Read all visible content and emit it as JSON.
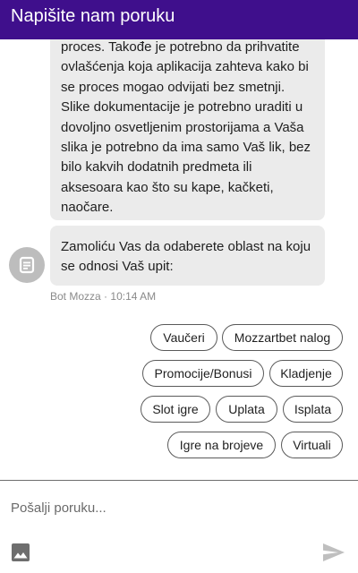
{
  "header": {
    "title": "Napišite nam poruku"
  },
  "messages": [
    {
      "sender": "bot",
      "lines": [
        "proces. Takođe je potrebno da prihvatite",
        "ovlašćenja koja aplikacija zahteva kako bi",
        "se proces mogao odvijati bez smetnji.",
        "Slike dokumentacije je potrebno uraditi u",
        "dovoljno osvetljenim prostorijama a Vaša",
        "slika je potrebno da ima samo Vaš lik, bez",
        "bilo kakvih dodatnih predmeta ili",
        "aksesoara kao što su kape, kačketi,",
        "naočare."
      ]
    },
    {
      "sender": "bot",
      "lines": [
        "Zamoliću Vas da odaberete oblast na koju",
        "se odnosi Vaš upit:"
      ]
    }
  ],
  "meta": {
    "sender_name": "Bot Mozza",
    "separator": "·",
    "time": "10:14 AM"
  },
  "quick_replies": [
    "Vaučeri",
    "Mozzartbet nalog",
    "Promocije/Bonusi",
    "Kladjenje",
    "Slot igre",
    "Uplata",
    "Isplata",
    "Igre na brojeve",
    "Virtuali"
  ],
  "composer": {
    "placeholder": "Pošalji poruku..."
  },
  "icons": {
    "avatar": "bot-message-icon",
    "attach": "image-icon",
    "send": "send-icon"
  },
  "colors": {
    "header_bg": "#3f0f8c",
    "bubble_bg": "#ebebeb",
    "icon_gray": "#6e6e6e"
  }
}
